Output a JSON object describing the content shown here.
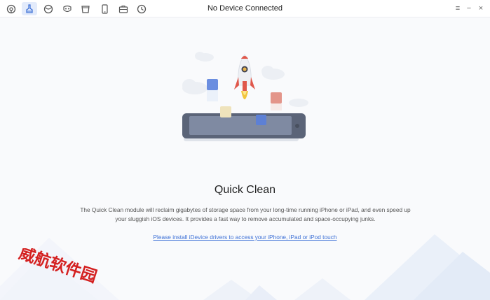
{
  "window": {
    "title": "No Device Connected"
  },
  "toolbar": {
    "items": [
      {
        "name": "ios-mover-icon",
        "active": false
      },
      {
        "name": "quick-clean-icon",
        "active": true
      },
      {
        "name": "deep-clean-icon",
        "active": false
      },
      {
        "name": "privacy-icon",
        "active": false
      },
      {
        "name": "app-clean-icon",
        "active": false
      },
      {
        "name": "phone-icon",
        "active": false
      },
      {
        "name": "toolbox-icon",
        "active": false
      },
      {
        "name": "history-icon",
        "active": false
      }
    ],
    "menu_glyph": "≡",
    "minimize_glyph": "−",
    "close_glyph": "×"
  },
  "main": {
    "heading": "Quick Clean",
    "description": "The Quick Clean module will reclaim gigabytes of storage space from your long-time running iPhone or iPad, and even speed up your sluggish iOS devices. It provides a fast way to remove accumulated and space-occupying junks.",
    "install_link": "Please install iDevice drivers to access your iPhone, iPad or iPod touch"
  },
  "watermark": {
    "text": "威航软件园",
    "color": "#d42020"
  },
  "colors": {
    "accent": "#3b6fd6",
    "background": "#f9fafc"
  }
}
